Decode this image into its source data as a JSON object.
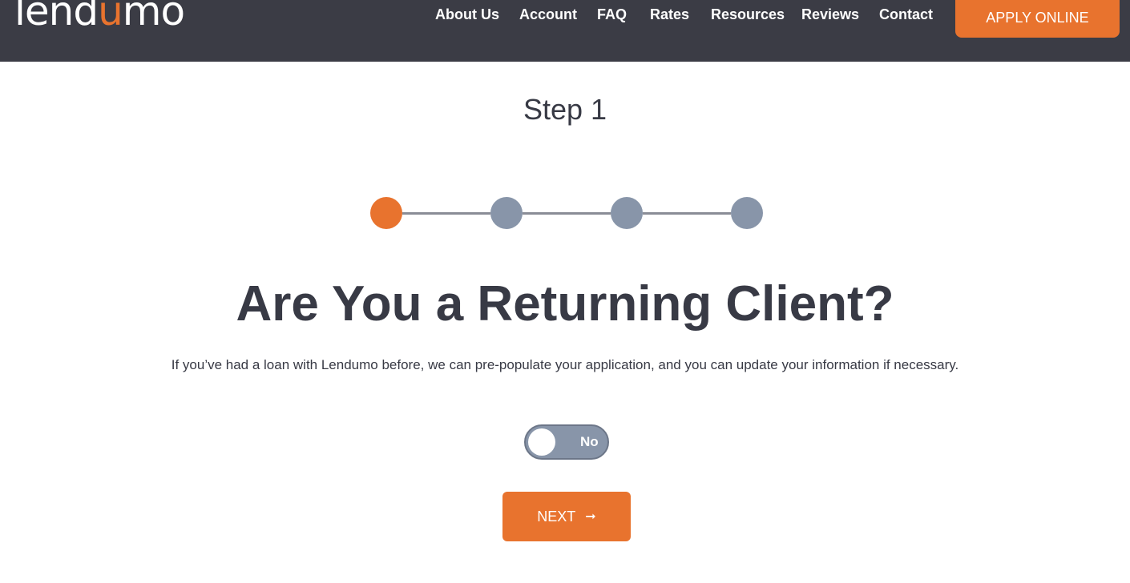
{
  "header": {
    "logo_left": "lend",
    "logo_u": "ü",
    "logo_right": "mo",
    "nav": [
      "About Us",
      "Account",
      "FAQ",
      "Rates",
      "Resources",
      "Reviews",
      "Contact"
    ],
    "apply_label": "APPLY ONLINE"
  },
  "main": {
    "step_title": "Step 1",
    "steps": {
      "total": 4,
      "current": 1
    },
    "heading": "Are You a Returning Client?",
    "subtext": "If you’ve had a loan with Lendumo before, we can pre-populate your application, and you can update your information if necessary.",
    "toggle": {
      "state_label": "No",
      "checked": false
    },
    "next_label": "NEXT",
    "next_icon": "arrow-right-icon"
  },
  "colors": {
    "header_bg": "#3b3c45",
    "accent": "#e8732e",
    "inactive_step": "#8895a9",
    "text": "#383a45"
  }
}
